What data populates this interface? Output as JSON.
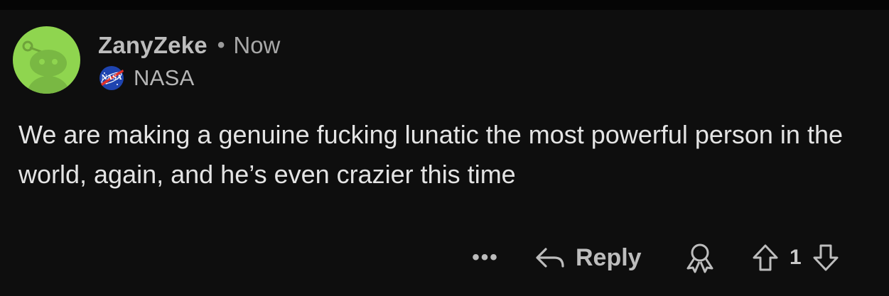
{
  "comment": {
    "author": "ZanyZeke",
    "separator": "•",
    "timestamp": "Now",
    "flair": {
      "icon": "nasa-meatball-icon",
      "text": "NASA"
    },
    "body": "We are making a genuine fucking lunatic the most powerful person in the world, again, and he’s even crazier this time",
    "avatar": {
      "icon": "snoo-avatar-icon",
      "background_color": "#8fd54f"
    }
  },
  "actions": {
    "more_label": "•••",
    "reply_label": "Reply",
    "reply_icon": "reply-arrow-icon",
    "award_icon": "award-icon",
    "upvote_icon": "upvote-arrow-icon",
    "downvote_icon": "downvote-arrow-icon",
    "vote_count": "1"
  },
  "colors": {
    "background": "#0e0e0e",
    "text": "#e4e4e4",
    "muted_text": "#a8a8a8",
    "avatar_green": "#8fd54f"
  }
}
